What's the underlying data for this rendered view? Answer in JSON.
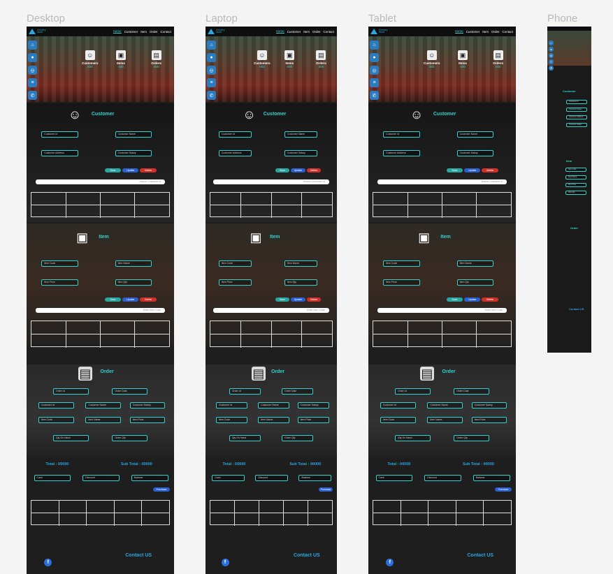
{
  "frames": [
    {
      "label": "Desktop"
    },
    {
      "label": "Laptop"
    },
    {
      "label": "Tablet"
    },
    {
      "label": "Phone"
    }
  ],
  "nav": {
    "logo": "Grocery Store",
    "links": [
      "Home",
      "Customer",
      "Item",
      "Order",
      "Contact"
    ]
  },
  "sidebar_icons": [
    "home-icon",
    "user-icon",
    "globe-icon",
    "list-icon",
    "phone-icon"
  ],
  "stats": [
    {
      "label": "Customers",
      "value": "000",
      "icon": "customer-icon"
    },
    {
      "label": "Items",
      "value": "000",
      "icon": "box-icon"
    },
    {
      "label": "Orders",
      "value": "000",
      "icon": "clipboard-icon"
    }
  ],
  "customer": {
    "title": "Customer",
    "fields": [
      "Customer Id",
      "Customer Name",
      "Customer Address",
      "Customer Salary"
    ],
    "buttons": [
      "Save",
      "Update",
      "Delete"
    ],
    "search_placeholder": "Search Customer Id"
  },
  "item": {
    "title": "Item",
    "fields": [
      "Item Code",
      "Item Name",
      "Item Price",
      "Item Qty"
    ],
    "buttons": [
      "Save",
      "Update",
      "Delete"
    ],
    "search_placeholder": "Enter Item Code"
  },
  "order": {
    "title": "Order",
    "fields": [
      "Order Id",
      "Order Date",
      "Customer Id",
      "Customer Name",
      "Customer Salary",
      "Item Code",
      "Item Name",
      "Item Price",
      "Qty On Hand",
      "Order Qty"
    ]
  },
  "totals": {
    "total": "Total : 00000",
    "subtotal": "Sub Total : 00000",
    "fields": [
      "Cash",
      "Discount",
      "Balance"
    ],
    "purchase": "Purchase"
  },
  "footer": {
    "contact": "Contact US",
    "facebook": "f"
  },
  "colors": {
    "accent": "#2fd3d0",
    "blue": "#2aa6e0",
    "save": "#2aa6a0",
    "update": "#2a5fd0",
    "delete": "#d0302a"
  }
}
